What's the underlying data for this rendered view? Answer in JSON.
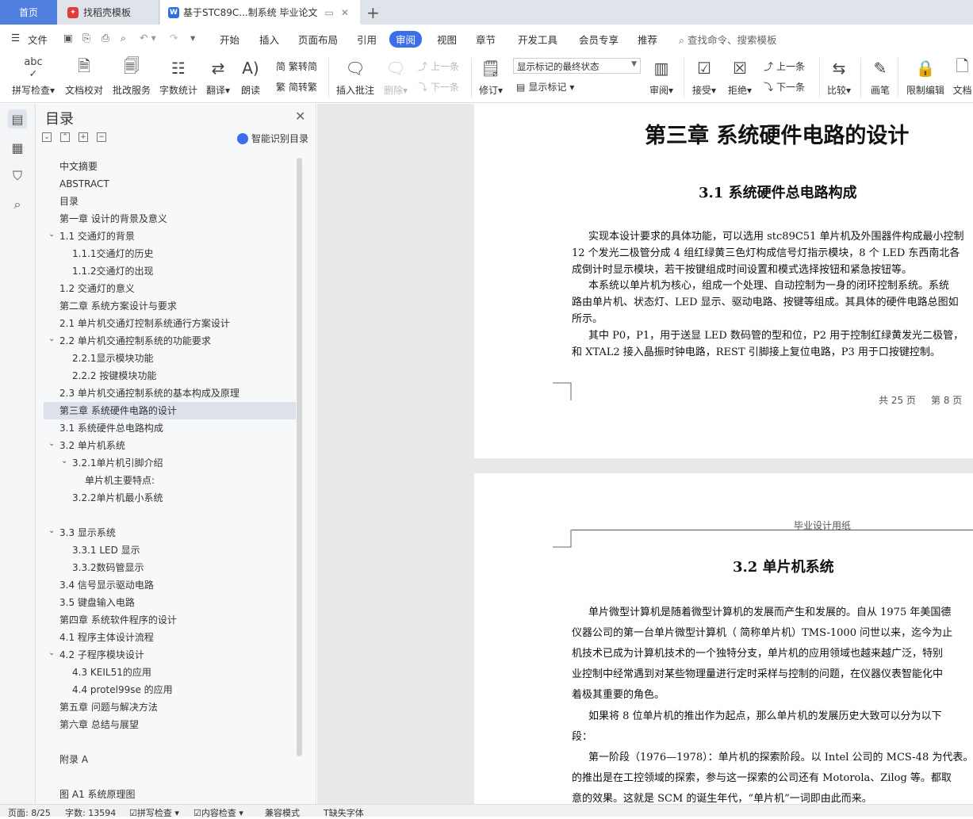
{
  "tabs": {
    "home": "首页",
    "template": "找稻壳模板",
    "doc": "基于STC89C...制系统 毕业论文"
  },
  "menu": [
    "文件",
    "开始",
    "插入",
    "页面布局",
    "引用",
    "审阅",
    "视图",
    "章节",
    "开发工具",
    "会员专享",
    "推荐"
  ],
  "menu_active": "审阅",
  "menu_search": "查找命令、搜索模板",
  "ribbon": {
    "spell": "拼写检查",
    "proof": "文档校对",
    "batch": "批改服务",
    "count": "字数统计",
    "translate": "翻译",
    "read": "朗读",
    "trad": "繁转简",
    "simp": "简转繁",
    "insert_comment": "插入批注",
    "delete": "删除",
    "prev": "上一条",
    "next": "下一条",
    "revise": "修订",
    "markup_select": "显示标记的最终状态",
    "show_markup": "显示标记",
    "review": "审阅",
    "accept": "接受",
    "reject": "拒绝",
    "prev2": "上一条",
    "next2": "下一条",
    "compare": "比较",
    "pen": "画笔",
    "restrict": "限制编辑",
    "doc": "文档"
  },
  "toc": {
    "title": "目录",
    "smart": "智能识别目录",
    "items": [
      {
        "text": "中文摘要",
        "indent": 0
      },
      {
        "text": "ABSTRACT",
        "indent": 0
      },
      {
        "text": "目录",
        "indent": 0
      },
      {
        "text": "第一章  设计的背景及意义",
        "indent": 0
      },
      {
        "text": "1.1 交通灯的背景",
        "indent": 0,
        "chev": true
      },
      {
        "text": "1.1.1交通灯的历史",
        "indent": 1
      },
      {
        "text": "1.1.2交通灯的出现",
        "indent": 1
      },
      {
        "text": "1.2 交通灯的意义",
        "indent": 0
      },
      {
        "text": "第二章    系统方案设计与要求",
        "indent": 0
      },
      {
        "text": "2.1 单片机交通灯控制系统通行方案设计",
        "indent": 0
      },
      {
        "text": "2.2 单片机交通控制系统的功能要求",
        "indent": 0,
        "chev": true
      },
      {
        "text": "2.2.1显示模块功能",
        "indent": 1
      },
      {
        "text": "2.2.2  按键模块功能",
        "indent": 1
      },
      {
        "text": "2.3 单片机交通控制系统的基本构成及原理",
        "indent": 0
      },
      {
        "text": "第三章  系统硬件电路的设计",
        "indent": 0,
        "sel": true
      },
      {
        "text": "3.1 系统硬件总电路构成",
        "indent": 0
      },
      {
        "text": "3.2 单片机系统",
        "indent": 0,
        "chev": true
      },
      {
        "text": "3.2.1单片机引脚介绍",
        "indent": 1,
        "chev": true
      },
      {
        "text": "单片机主要特点:",
        "indent": 2
      },
      {
        "text": "3.2.2单片机最小系统",
        "indent": 1
      },
      {
        "text": "",
        "indent": 0
      },
      {
        "text": "3.3 显示系统",
        "indent": 0,
        "chev": true
      },
      {
        "text": "3.3.1 LED 显示",
        "indent": 1
      },
      {
        "text": "3.3.2数码管显示",
        "indent": 1
      },
      {
        "text": "3.4 信号显示驱动电路",
        "indent": 0
      },
      {
        "text": "3.5 键盘输入电路",
        "indent": 0
      },
      {
        "text": "第四章  系统软件程序的设计",
        "indent": 0
      },
      {
        "text": "4.1 程序主体设计流程",
        "indent": 0
      },
      {
        "text": "4.2 子程序模块设计",
        "indent": 0,
        "chev": true
      },
      {
        "text": "4.3  KEIL51的应用",
        "indent": 1
      },
      {
        "text": "4.4  protel99se 的应用",
        "indent": 1
      },
      {
        "text": "第五章  问题与解决方法",
        "indent": 0
      },
      {
        "text": "第六章  总结与展望",
        "indent": 0
      },
      {
        "text": "",
        "indent": 0
      },
      {
        "text": "附录 A",
        "indent": 0
      },
      {
        "text": "",
        "indent": 0
      },
      {
        "text": "图 A1  系统原理图",
        "indent": 0
      }
    ]
  },
  "page1": {
    "chapter": "第三章  系统硬件电路的设计",
    "section": "3.1 系统硬件总电路构成",
    "lines": [
      "实现本设计要求的具体功能，可以选用 stc89C51 单片机及外围器件构成最小控制",
      "12 个发光二极管分成 4 组红绿黄三色灯构成信号灯指示模块，8 个 LED 东西南北各",
      "成倒计时显示模块，若干按键组成时间设置和模式选择按钮和紧急按钮等。",
      "本系统以单片机为核心，组成一个处理、自动控制为一身的闭环控制系统。系统",
      "路由单片机、状态灯、LED 显示、驱动电路、按键等组成。其具体的硬件电路总图如",
      "所示。",
      "其中 P0，P1，用于送显 LED 数码管的型和位，P2 用于控制红绿黄发光二极管，",
      "和 XTAL2 接入晶振时钟电路，REST 引脚接上复位电路，P3 用于口按键控制。"
    ],
    "total_pages": "共 25 页",
    "current_page": "第 8 页"
  },
  "page2": {
    "header": "毕业设计用纸",
    "section": "3.2 单片机系统",
    "lines": [
      "单片微型计算机是随着微型计算机的发展而产生和发展的。自从 1975 年美国德",
      "仪器公司的第一台单片微型计算机（ 简称单片机）TMS-1000 问世以来，迄今为止",
      "机技术已成为计算机技术的一个独特分支，单片机的应用领域也越来越广泛，特别",
      "业控制中经常遇到对某些物理量进行定时采样与控制的问题，在仪器仪表智能化中",
      "着极其重要的角色。",
      "如果将 8 位单片机的推出作为起点，那么单片机的发展历史大致可以分为以下",
      "段：",
      "第一阶段（1976—1978）：单片机的探索阶段。以 Intel 公司的 MCS-48 为代表。",
      "的推出是在工控领域的探索，参与这一探索的公司还有 Motorola、Zilog 等。都取",
      "意的效果。这就是 SCM 的诞生年代，“单片机”一词即由此而来。"
    ]
  },
  "status": {
    "page": "页面: 8/25",
    "words": "字数: 13594",
    "spell": "拼写检查",
    "content": "内容检查",
    "compat": "兼容模式",
    "font": "缺失字体"
  }
}
